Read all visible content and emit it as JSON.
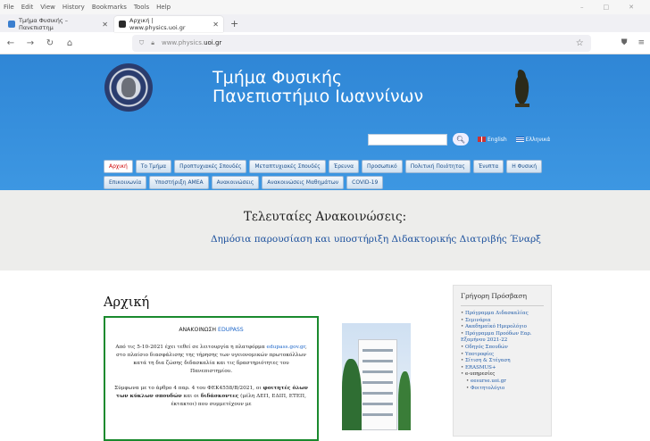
{
  "browser": {
    "menu": [
      "File",
      "Edit",
      "View",
      "History",
      "Bookmarks",
      "Tools",
      "Help"
    ],
    "tabs": [
      {
        "title": "Τμήμα Φυσικής – Πανεπιστημ",
        "active": false,
        "icon_color": "#3b7fcf"
      },
      {
        "title": "Αρχική | www.physics.uoi.gr",
        "active": true,
        "icon_color": "#2b2b2b"
      }
    ],
    "url_prefix": "www.physics.",
    "url_domain": "uoi.gr"
  },
  "header": {
    "title_line1": "Τμήμα Φυσικής",
    "title_line2": "Πανεπιστήμιο Ιωαννίνων",
    "search_placeholder": "",
    "lang_english": "English",
    "lang_greek": "Ελληνικά"
  },
  "nav": [
    "Αρχική",
    "Το Τμήμα",
    "Προπτυχιακές Σπουδές",
    "Μεταπτυχιακές Σπουδές",
    "Έρευνα",
    "Προσωπικό",
    "Πολιτική Ποιότητας",
    "Ένυπτα",
    "Η Φυσική",
    "Επικοινωνία",
    "Υποστήριξη ΑΜΕΑ",
    "Ανακοινώσεις",
    "Ανακοινώσεις Μαθημάτων",
    "COVID-19"
  ],
  "announcements": {
    "heading": "Τελευταίες Ανακοινώσεις:",
    "ticker": "Δημόσια παρουσίαση και υποστήριξη Διδακτορικής Διατριβής     Έναρξ"
  },
  "main": {
    "title": "Αρχική",
    "notice_label": "ΑΝΑΚΟΙΝΩΣΗ",
    "notice_brand": "EDUPASS",
    "para1_a": "Από τις 5-10-2021 έχει τεθεί σε λειτουργία η πλατφόρμα",
    "para1_link": "edupass.gov.gr",
    "para1_b": ", στο πλαίσιο διασφάλισης της τήρησης των υγειονομικών πρωτοκόλλων κατά τη δια ζώσης διδασκαλία και τις δραστηριότητες του Πανεπιστημίου.",
    "para2_a": "Σύμφωνα με το άρθρο 4 παρ. 4 του ΦΕΚ4558/Β/2021, οι",
    "para2_b": "φοιτητές όλων των κύκλων σπουδών",
    "para2_c": "και οι",
    "para2_d": "διδάσκοντες",
    "para2_e": "(μέλη ΔΕΠ, ΕΔΙΠ, ΕΤΕΠ, έκτακτοι) που συμμετέχουν με"
  },
  "sidebar": {
    "title": "Γρήγορη Πρόσβαση",
    "items": [
      {
        "label": "Πρόγραμμα Διδασκαλίας",
        "kind": "item"
      },
      {
        "label": "Σεμινάρια",
        "kind": "item"
      },
      {
        "label": "Ακαδημαϊκό Ημερολόγιο",
        "kind": "item"
      },
      {
        "label": "Πρόγραμμα Προόδων Εαρ. Εξαμήνου 2021-22",
        "kind": "item"
      },
      {
        "label": "Οδηγός Σπουδών",
        "kind": "item"
      },
      {
        "label": "Υποτροφίες",
        "kind": "item"
      },
      {
        "label": "Σίτιση & Στέγαση",
        "kind": "item"
      },
      {
        "label": "ERASMUS+",
        "kind": "item"
      },
      {
        "label": "e-υπηρεσίες",
        "kind": "grp"
      },
      {
        "label": "eesurse.uoi.gr",
        "kind": "sub"
      },
      {
        "label": "Φοιτητολόγιο",
        "kind": "sub"
      }
    ]
  },
  "colors": {
    "header_blue": "#3a92df",
    "accent_green": "#1a8a2e",
    "link_blue": "#1e5aa8"
  }
}
